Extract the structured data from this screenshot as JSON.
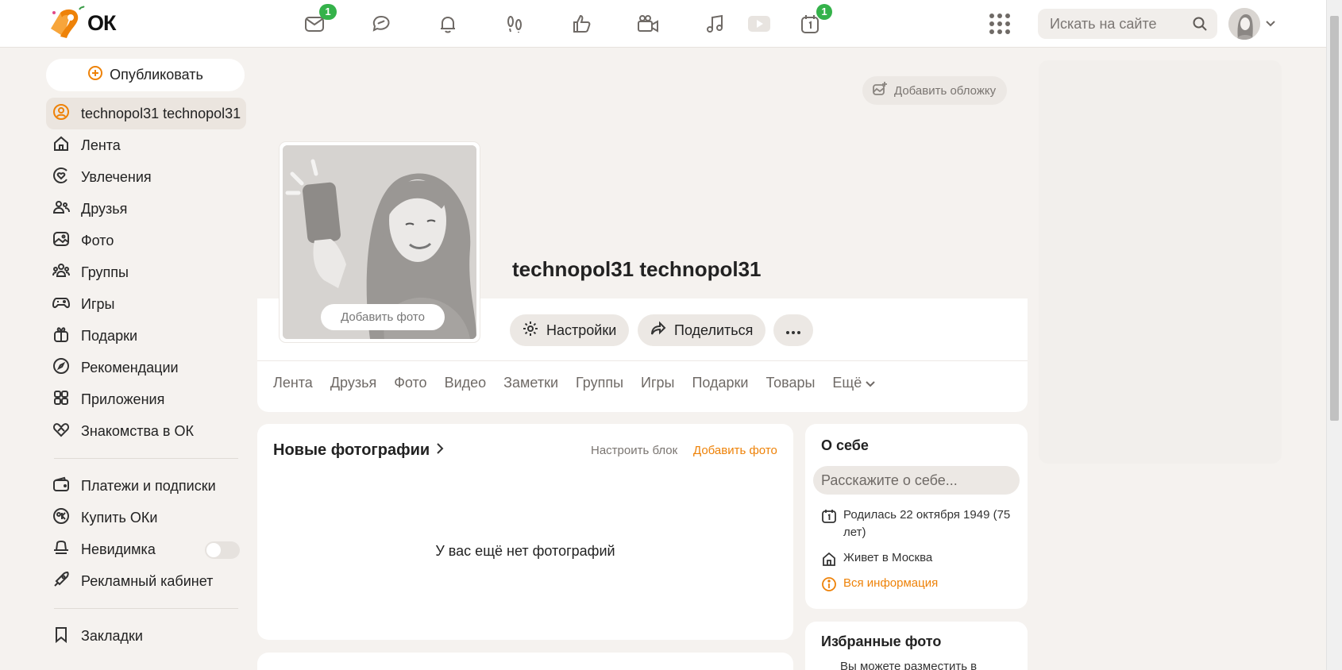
{
  "header": {
    "logo_text": "ОК",
    "messages_badge": "1",
    "events_badge": "1",
    "search_placeholder": "Искать на сайте"
  },
  "sidebar": {
    "publish_label": "Опубликовать",
    "items": [
      {
        "label": "technopol31 technopol31",
        "icon": "profile-icon"
      },
      {
        "label": "Лента",
        "icon": "home-icon"
      },
      {
        "label": "Увлечения",
        "icon": "hobbies-icon"
      },
      {
        "label": "Друзья",
        "icon": "friends-icon"
      },
      {
        "label": "Фото",
        "icon": "photo-icon"
      },
      {
        "label": "Группы",
        "icon": "groups-icon"
      },
      {
        "label": "Игры",
        "icon": "games-icon"
      },
      {
        "label": "Подарки",
        "icon": "gifts-icon"
      },
      {
        "label": "Рекомендации",
        "icon": "compass-icon"
      },
      {
        "label": "Приложения",
        "icon": "apps-grid-icon"
      },
      {
        "label": "Знакомства в ОК",
        "icon": "dating-icon"
      }
    ],
    "items2": [
      {
        "label": "Платежи и подписки",
        "icon": "wallet-icon"
      },
      {
        "label": "Купить ОКи",
        "icon": "coin-icon"
      },
      {
        "label": "Невидимка",
        "icon": "incognito-icon"
      },
      {
        "label": "Рекламный кабинет",
        "icon": "ads-icon"
      }
    ],
    "bookmarks_label": "Закладки"
  },
  "profile": {
    "add_cover_label": "Добавить обложку",
    "add_photo_label": "Добавить фото",
    "name": "technopol31 technopol31",
    "settings_label": "Настройки",
    "share_label": "Поделиться",
    "tabs": [
      "Лента",
      "Друзья",
      "Фото",
      "Видео",
      "Заметки",
      "Группы",
      "Игры",
      "Подарки",
      "Товары"
    ],
    "more_label": "Ещё"
  },
  "photos_block": {
    "title": "Новые фотографии",
    "configure_label": "Настроить блок",
    "add_label": "Добавить фото",
    "empty_text": "У вас ещё нет фотографий"
  },
  "about": {
    "title": "О себе",
    "placeholder": "Расскажите о себе...",
    "birth": "Родилась 22 октября 1949 (75 лет)",
    "lives": "Живет в Москва",
    "all_info": "Вся информация"
  },
  "favorites": {
    "title": "Избранные фото",
    "text": "Вы можете разместить в"
  },
  "colors": {
    "accent": "#ee8208",
    "badge": "#34b24a"
  }
}
